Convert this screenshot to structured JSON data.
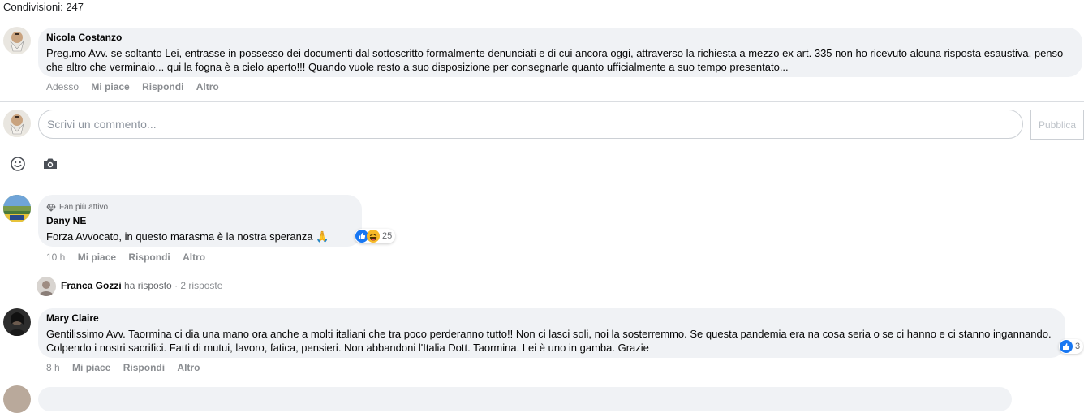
{
  "shares": {
    "label": "Condivisioni: 247"
  },
  "comments": [
    {
      "author": "Nicola Costanzo",
      "text": "Preg.mo Avv. se soltanto Lei, entrasse in possesso dei documenti dal sottoscritto formalmente denunciati e di cui ancora oggi, attraverso la richiesta a mezzo ex art. 335 non ho ricevuto alcuna risposta esaustiva, penso che altro che verminaio... qui la fogna è a cielo aperto!!! Quando vuole resto a suo disposizione per consegnarle quanto ufficialmente a suo tempo presentato...",
      "time": "Adesso",
      "like": "Mi piace",
      "reply": "Rispondi",
      "more": "Altro"
    },
    {
      "badge": "Fan più attivo",
      "author": "Dany NE",
      "text": "Forza Avvocato, in questo marasma è la nostra speranza 🙏",
      "reaction_count": "25",
      "time": "10 h",
      "like": "Mi piace",
      "reply": "Rispondi",
      "more": "Altro"
    },
    {
      "author": "Mary Claire",
      "text": "Gentilissimo Avv. Taormina ci dia una mano ora anche a molti italiani che tra poco perderanno tutto!! Non ci lasci soli, noi la sosterremmo. Se questa pandemia era na cosa seria o se ci hanno e ci stanno ingannando. Colpendo i nostri sacrifici. Fatti di mutui, lavoro, fatica, pensieri. Non abbandoni l'Italia Dott. Taormina. Lei è uno in gamba. Grazie",
      "reaction_count": "3",
      "time": "8 h",
      "like": "Mi piace",
      "reply": "Rispondi",
      "more": "Altro"
    }
  ],
  "composer": {
    "placeholder": "Scrivi un commento...",
    "publish_label": "Pubblica",
    "emoji_icon": "smiley-icon",
    "camera_icon": "camera-icon"
  },
  "reply_summary": {
    "name": "Franca Gozzi",
    "action": "ha risposto",
    "count": "· 2 risposte"
  },
  "colors": {
    "bubble": "#f0f2f5",
    "like_blue": "#1877f2",
    "haha_yellow": "#f7b928",
    "muted": "#65676b"
  }
}
